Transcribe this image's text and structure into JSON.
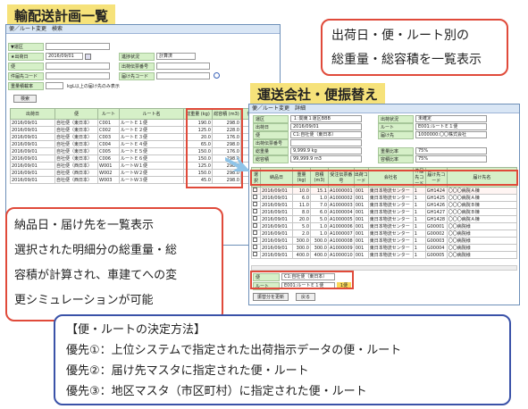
{
  "title_left": "輸配送計画一覧",
  "title_right": "運送会社・便振替え",
  "callout_top": [
    "出荷日・便・ルート別の",
    "総重量・総容積を一覧表示"
  ],
  "callout_left": [
    "納品日・届け先を一覧表示",
    "選択された明細分の総重量・総",
    "容積が計算され、車建てへの変",
    "更シミュレーションが可能"
  ],
  "method_box": [
    "【便・ルートの決定方法】",
    "優先①：上位システムで指定された出荷指示データの便・ルート",
    "優先②：届け先マスタに指定された便・ルート",
    "優先③：地区マスタ（市区町村）に指定された便・ルート"
  ],
  "win1": {
    "header": "便／ルート変更　検索",
    "labels": [
      "▼運区",
      "★出荷日",
      "便",
      "件届先コード",
      "重量積載率",
      "進捗状況",
      "出荷伝票番号",
      "届け先コード"
    ],
    "ship_date": "2016/09/01",
    "status_value": "計算済",
    "weight_note": "kgL以上の届け先のみ表示",
    "search_btn": "検索",
    "columns": [
      "出荷日",
      "便",
      "ルート",
      "ルート名",
      "総重量 (kg)",
      "総容積 (m3)",
      "件数ルート"
    ],
    "rows": [
      [
        "2016/09/01",
        "自社便（東日本）",
        "C001",
        "ルートＥ１便",
        "190.0",
        "298.0"
      ],
      [
        "2016/09/01",
        "自社便（東日本）",
        "C002",
        "ルートＥ２便",
        "125.0",
        "228.0"
      ],
      [
        "2016/09/01",
        "自社便（東日本）",
        "C003",
        "ルートＥ３便",
        "20.0",
        "176.0"
      ],
      [
        "2016/09/01",
        "自社便（東日本）",
        "C004",
        "ルートＥ４便",
        "65.0",
        "298.0"
      ],
      [
        "2016/09/01",
        "自社便（東日本）",
        "C005",
        "ルートＥ５便",
        "150.0",
        "176.0"
      ],
      [
        "2016/09/01",
        "自社便（東日本）",
        "C006",
        "ルートＥ６便",
        "150.0",
        "298.0"
      ],
      [
        "2016/09/01",
        "自社便（西日本）",
        "W001",
        "ルートＷ１便",
        "125.0",
        "298.0"
      ],
      [
        "2016/09/01",
        "自社便（西日本）",
        "W002",
        "ルートＷ２便",
        "150.0",
        "298.0"
      ],
      [
        "2016/09/01",
        "自社便（西日本）",
        "W003",
        "ルートＷ３便",
        "45.0",
        "298.0"
      ]
    ]
  },
  "win2": {
    "header": "便／ルート変更　詳細",
    "info": [
      [
        "運区",
        "１:関東１運区BBB",
        "出荷状況",
        "未確定"
      ],
      [
        "出荷日",
        "2016/09/01",
        "ルート",
        "E001:ルートＥ１便"
      ],
      [
        "便",
        "C1:自社便（東日本）",
        "届け先",
        "1000000:〇〇株式会社"
      ],
      [
        "出荷伝票番号",
        "",
        "",
        ""
      ],
      [
        "総重量",
        "9,999.9 kg",
        "重量比率",
        "75%"
      ],
      [
        "総容積",
        "99,999.9 m3",
        "容積比率",
        "75%"
      ]
    ],
    "columns": [
      "選択",
      "納品日",
      "重量(kg)",
      "容積(m3)",
      "受注伝票番号",
      "出荷コード",
      "会社名",
      "件届先コード",
      "届け先コード",
      "届け先名"
    ],
    "rows": [
      [
        "2016/09/01",
        "10.0",
        "15.1",
        "A1000001",
        "001",
        "東日本物流センター",
        "1",
        "GH1424",
        "〇〇〇病院Ａ棟"
      ],
      [
        "2016/09/01",
        "6.0",
        "1.0",
        "A1000002",
        "001",
        "東日本物流センター",
        "1",
        "GH1425",
        "〇〇〇病院Ａ棟"
      ],
      [
        "2016/09/01",
        "11.0",
        "7.0",
        "A1000003",
        "001",
        "東日本物流センター",
        "1",
        "GH1426",
        "〇〇〇病院Ｂ棟"
      ],
      [
        "2016/09/01",
        "8.0",
        "6.0",
        "A1000004",
        "001",
        "東日本物流センター",
        "1",
        "GH1427",
        "〇〇〇病院Ｂ棟"
      ],
      [
        "2016/09/01",
        "20.0",
        "5.0",
        "A1000005",
        "001",
        "東日本物流センター",
        "1",
        "GH1428",
        "〇〇〇病院Ａ棟"
      ],
      [
        "2016/09/01",
        "5.0",
        "1.0",
        "A1000006",
        "001",
        "東日本物流センター",
        "1",
        "G00001",
        "〇〇病院様"
      ],
      [
        "2016/09/01",
        "2.0",
        "1.0",
        "A1000007",
        "001",
        "東日本物流センター",
        "1",
        "G00002",
        "〇〇病院様"
      ],
      [
        "2016/09/01",
        "300.0",
        "300.0",
        "A1000008",
        "001",
        "東日本物流センター",
        "1",
        "G00003",
        "〇〇病院様"
      ],
      [
        "2016/09/01",
        "300.0",
        "300.0",
        "A1000009",
        "001",
        "東日本物流センター",
        "1",
        "G00004",
        "〇〇病院様"
      ],
      [
        "2016/09/01",
        "400.0",
        "400.0",
        "A1000010",
        "001",
        "東日本物流センター",
        "1",
        "G00005",
        "〇〇病院様"
      ]
    ],
    "bin_label": "便",
    "bin_value": "C1:自社便（東日本）",
    "route_label": "ルート",
    "route_value": "E001:ルートＥ１便",
    "route_badge": "1便",
    "apply_btn": "振替分を更新",
    "back_btn": "戻る"
  }
}
